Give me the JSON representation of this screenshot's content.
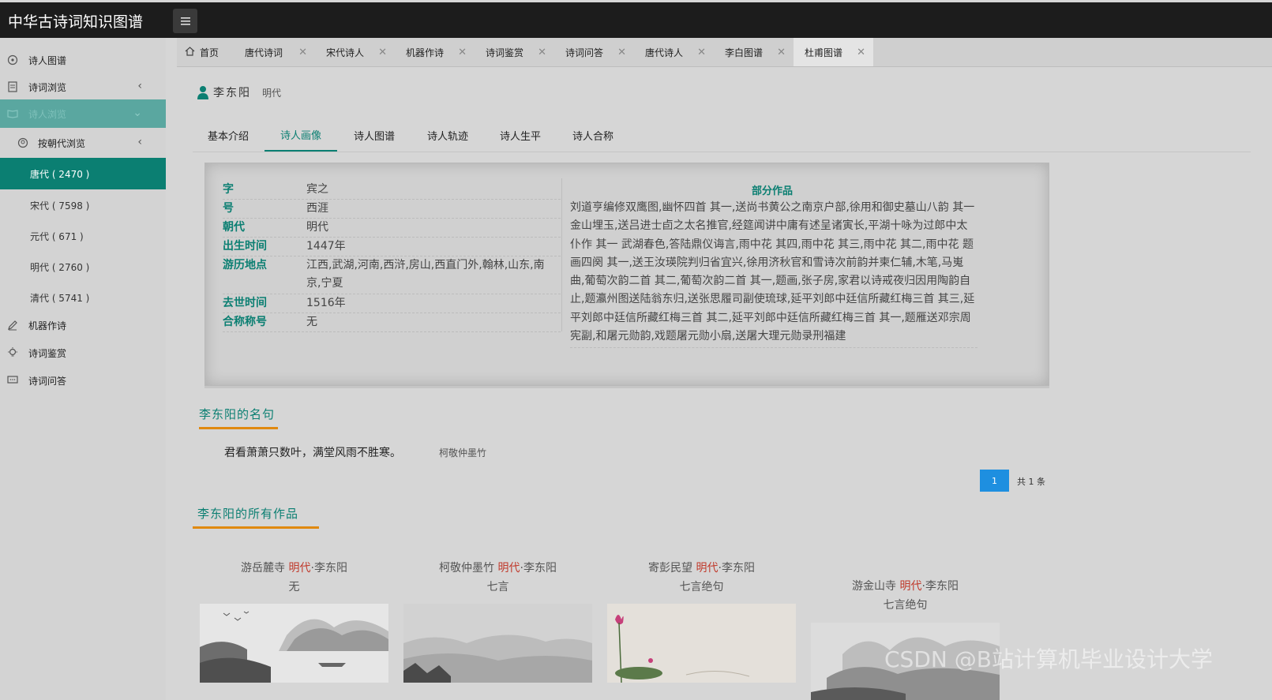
{
  "header": {
    "title": "中华古诗词知识图谱"
  },
  "sidebar": {
    "items": [
      {
        "label": "诗人图谱",
        "icon": "network-icon"
      },
      {
        "label": "诗词浏览",
        "icon": "document-icon"
      },
      {
        "label": "诗人浏览",
        "icon": "book-icon"
      },
      {
        "label": "按朝代浏览",
        "icon": "user-circle-icon"
      },
      {
        "label": "机器作诗",
        "icon": "pen-icon"
      },
      {
        "label": "诗词鉴赏",
        "icon": "lightbulb-icon"
      },
      {
        "label": "诗词问答",
        "icon": "chat-icon"
      }
    ],
    "dynasties": [
      {
        "label": "唐代 ( 2470 )"
      },
      {
        "label": "宋代 ( 7598 )"
      },
      {
        "label": "元代 ( 671 )"
      },
      {
        "label": "明代 ( 2760 )"
      },
      {
        "label": "清代 ( 5741 )"
      }
    ]
  },
  "tabs": [
    {
      "label": "首页"
    },
    {
      "label": "唐代诗词"
    },
    {
      "label": "宋代诗人"
    },
    {
      "label": "机器作诗"
    },
    {
      "label": "诗词鉴赏"
    },
    {
      "label": "诗词问答"
    },
    {
      "label": "唐代诗人"
    },
    {
      "label": "李白图谱"
    },
    {
      "label": "杜甫图谱"
    }
  ],
  "poet": {
    "name": "李东阳",
    "dynasty": "明代"
  },
  "subtabs": [
    "基本介绍",
    "诗人画像",
    "诗人图谱",
    "诗人轨迹",
    "诗人生平",
    "诗人合称"
  ],
  "info": [
    {
      "key": "字",
      "value": "宾之"
    },
    {
      "key": "号",
      "value": "西涯"
    },
    {
      "key": "朝代",
      "value": "明代"
    },
    {
      "key": "出生时间",
      "value": "1447年"
    },
    {
      "key": "游历地点",
      "value": "江西,武湖,河南,西浒,房山,西直门外,翰林,山东,南京,宁夏"
    },
    {
      "key": "去世时间",
      "value": "1516年"
    },
    {
      "key": "合称称号",
      "value": "无"
    }
  ],
  "works": {
    "title": "部分作品",
    "text": "刘道亨编修双鹰图,幽怀四首 其一,送尚书黄公之南京户部,徐用和御史墓山八韵 其一 金山埋玉,送吕进士卣之太名推官,经筵闻讲中庸有述呈诸寅长,平湖十咏为过郎中太仆作 其一 武湖春色,答陆鼎仪诲言,雨中花 其四,雨中花 其三,雨中花 其二,雨中花 题画四阕 其一,送王汝瑛院判归省宜兴,徐用济秋官和雪诗次前韵并柬仁辅,木笔,马嵬曲,葡萄次韵二首 其二,葡萄次韵二首 其一,题画,张子房,家君以诗戒夜归因用陶韵自止,题瀛州图送陆翁东归,送张思履司副使琉球,延平刘郎中廷信所藏红梅三首 其三,延平刘郎中廷信所藏红梅三首 其二,延平刘郎中廷信所藏红梅三首 其一,题雁送邓宗周宪副,和屠元勋韵,戏题屠元勋小扇,送屠大理元勋录刑福建"
  },
  "quotes": {
    "title": "李东阳的名句",
    "items": [
      {
        "text": "君看萧萧只数叶，满堂风雨不胜寒。",
        "source": "柯敬仲墨竹"
      }
    ]
  },
  "pagination": {
    "current": "1",
    "total": "共 1 条"
  },
  "all_works": {
    "title": "李东阳的所有作品",
    "cards": [
      {
        "title": "游岳麓寺 ",
        "dynasty": "明代",
        "author": "·李东阳",
        "subtitle": "无"
      },
      {
        "title": "柯敬仲墨竹 ",
        "dynasty": "明代",
        "author": "·李东阳",
        "subtitle": "七言"
      },
      {
        "title": "寄彭民望 ",
        "dynasty": "明代",
        "author": "·李东阳",
        "subtitle": "七言绝句"
      },
      {
        "title": "游金山寺 ",
        "dynasty": "明代",
        "author": "·李东阳",
        "subtitle": "七言绝句"
      }
    ]
  },
  "watermark": "CSDN @B站计算机毕业设计大学",
  "colors": {
    "accent": "#0b7f72",
    "header_bg": "#1c1c1c",
    "underline": "#e0890f",
    "dynasty_red": "#c0392b",
    "page_blue": "#1e8fe0"
  }
}
